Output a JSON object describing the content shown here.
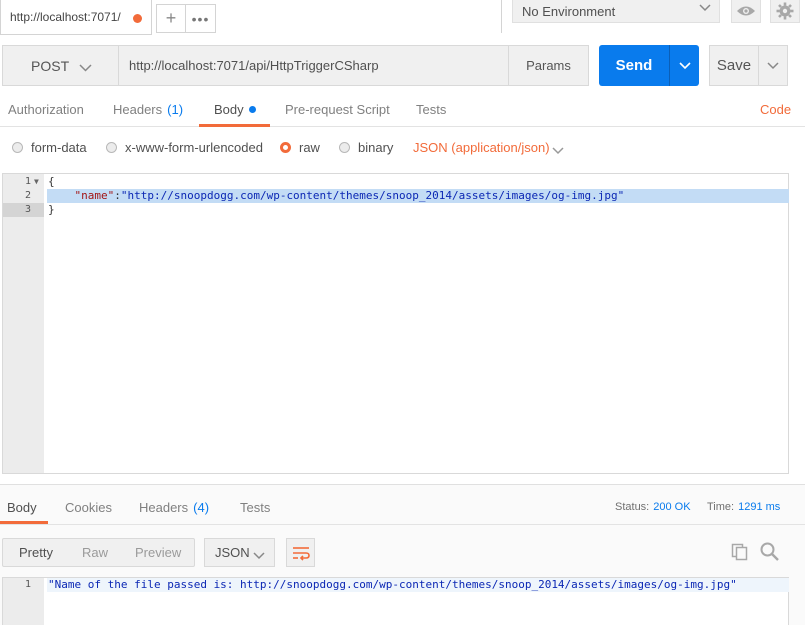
{
  "tab": {
    "title": "http://localhost:7071/"
  },
  "environment": {
    "selected": "No Environment"
  },
  "request": {
    "method": "POST",
    "url": "http://localhost:7071/api/HttpTriggerCSharp",
    "params_label": "Params",
    "send_label": "Send",
    "save_label": "Save"
  },
  "subtabs": {
    "authorization": "Authorization",
    "headers": "Headers",
    "headers_count": "(1)",
    "body": "Body",
    "prerequest": "Pre-request Script",
    "tests": "Tests",
    "code": "Code"
  },
  "body_types": {
    "form_data": "form-data",
    "urlencoded": "x-www-form-urlencoded",
    "raw": "raw",
    "binary": "binary",
    "selected": "raw",
    "content_type": "JSON (application/json)"
  },
  "editor": {
    "lines": [
      {
        "num": "1",
        "open": "{"
      },
      {
        "num": "2",
        "indent": "    ",
        "key": "\"name\"",
        "colon": ":",
        "value": "\"http://snoopdogg.com/wp-content/themes/snoop_2014/assets/images/og-img.jpg\""
      },
      {
        "num": "3",
        "close": "}"
      }
    ]
  },
  "response": {
    "tabs": {
      "body": "Body",
      "cookies": "Cookies",
      "headers": "Headers",
      "headers_count": "(4)",
      "tests": "Tests"
    },
    "status_label": "Status:",
    "status_value": "200 OK",
    "time_label": "Time:",
    "time_value": "1291 ms",
    "view_modes": {
      "pretty": "Pretty",
      "raw": "Raw",
      "preview": "Preview"
    },
    "format": "JSON",
    "line_num": "1",
    "body_text": "\"Name of the file passed is: http://snoopdogg.com/wp-content/themes/snoop_2014/assets/images/og-img.jpg\""
  },
  "colors": {
    "accent": "#f26b3a",
    "primary": "#097bed"
  }
}
